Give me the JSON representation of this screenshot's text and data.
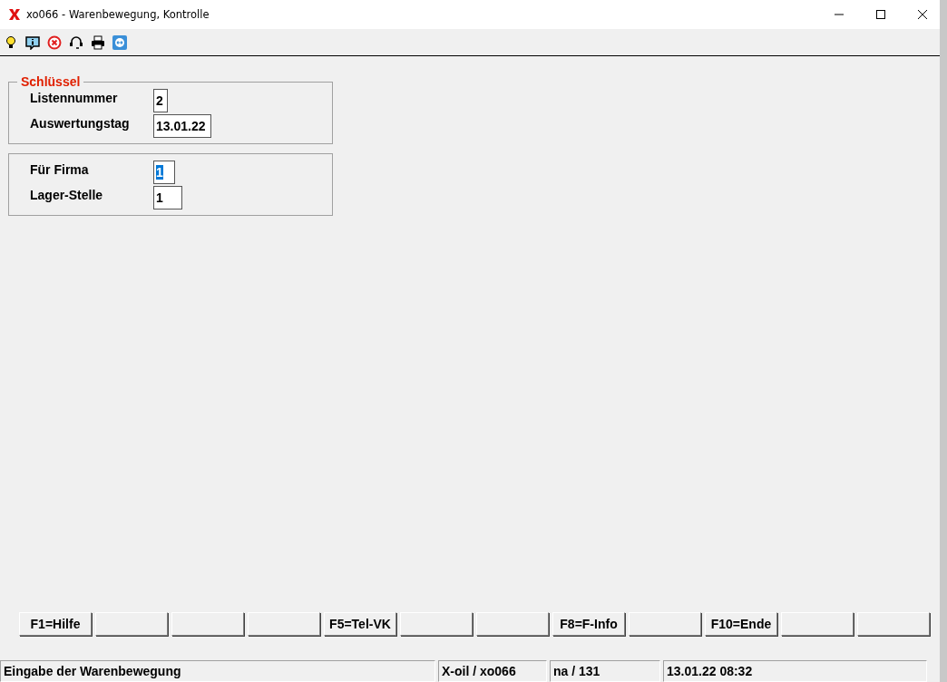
{
  "window": {
    "title": "xo066 - Warenbewegung, Kontrolle"
  },
  "groups": [
    {
      "legend": "Schlüssel",
      "fields": [
        {
          "label": "Listennummer",
          "value": "2",
          "selected": false
        },
        {
          "label": "Auswertungstag",
          "value": "13.01.22",
          "selected": false
        }
      ]
    },
    {
      "fields": [
        {
          "label": "Für Firma",
          "value": "1",
          "selected": true
        },
        {
          "label": "Lager-Stelle",
          "value": "1",
          "selected": false
        }
      ]
    }
  ],
  "function_keys": [
    {
      "kind": "labeled",
      "label": "F1=Hilfe"
    },
    {
      "kind": "blank"
    },
    {
      "kind": "blank"
    },
    {
      "kind": "blank"
    },
    {
      "kind": "labeled",
      "label": "F5=Tel-VK"
    },
    {
      "kind": "blank"
    },
    {
      "kind": "blank"
    },
    {
      "kind": "labeled",
      "label": "F8=F-Info"
    },
    {
      "kind": "blank"
    },
    {
      "kind": "labeled",
      "label": "F10=Ende"
    },
    {
      "kind": "blank"
    },
    {
      "kind": "blank"
    }
  ],
  "status_bar": [
    "Eingabe der Warenbewegung",
    "X-oil / xo066",
    "na / 131",
    "13.01.22 08:32"
  ]
}
